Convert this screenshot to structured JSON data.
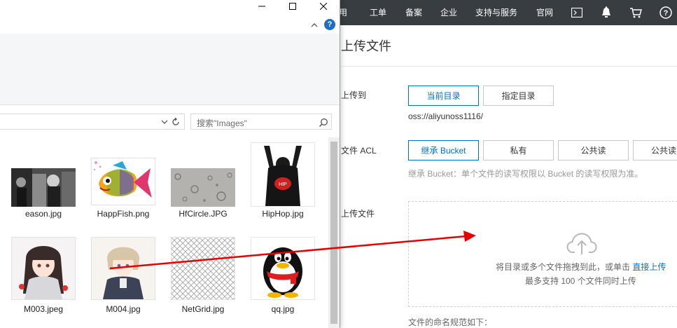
{
  "topnav": {
    "items": [
      "费用",
      "工单",
      "备案",
      "企业",
      "支持与服务",
      "官网"
    ],
    "partial_first": "用",
    "icons": [
      "terminal-icon",
      "bell-icon",
      "cart-icon",
      "help-icon"
    ]
  },
  "upload_panel": {
    "title": "上传文件",
    "upload_to_label": "上传到",
    "dest_buttons": [
      "当前目录",
      "指定目录"
    ],
    "dest_path": "oss://aliyunoss1116/",
    "acl_label": "文件 ACL",
    "acl_buttons": [
      "继承 Bucket",
      "私有",
      "公共读",
      "公共读写"
    ],
    "acl_hint": "继承 Bucket：单个文件的读写权限以 Bucket 的读写权限为准。",
    "upload_file_label": "上传文件",
    "drop_text": "将目录或多个文件拖拽到此，或单击",
    "drop_link": "直接上传",
    "drop_limit": "最多支持 100 个文件同时上传",
    "naming_note": "文件的命名规范如下："
  },
  "dialog": {
    "controls": {
      "minimize": "—",
      "maximize": "☐",
      "close": "✕"
    },
    "search_placeholder": "搜索\"Images\"",
    "files": [
      {
        "name": "eason.jpg",
        "thumb": "bw-photo"
      },
      {
        "name": "HappFish.png",
        "thumb": "fish"
      },
      {
        "name": "HfCircle.JPG",
        "thumb": "grey-texture"
      },
      {
        "name": "HipHop.jpg",
        "thumb": "hiphop-figure"
      },
      {
        "name": "M003.jpeg",
        "thumb": "anime-girl"
      },
      {
        "name": "M004.jpg",
        "thumb": "anime-boy"
      },
      {
        "name": "NetGrid.jpg",
        "thumb": "net-grid"
      },
      {
        "name": "qq.jpg",
        "thumb": "qq-penguin"
      }
    ]
  },
  "colors": {
    "nav_bg": "#373d41",
    "accent_blue": "#0070cc",
    "drag_arrow": "#e50000"
  }
}
